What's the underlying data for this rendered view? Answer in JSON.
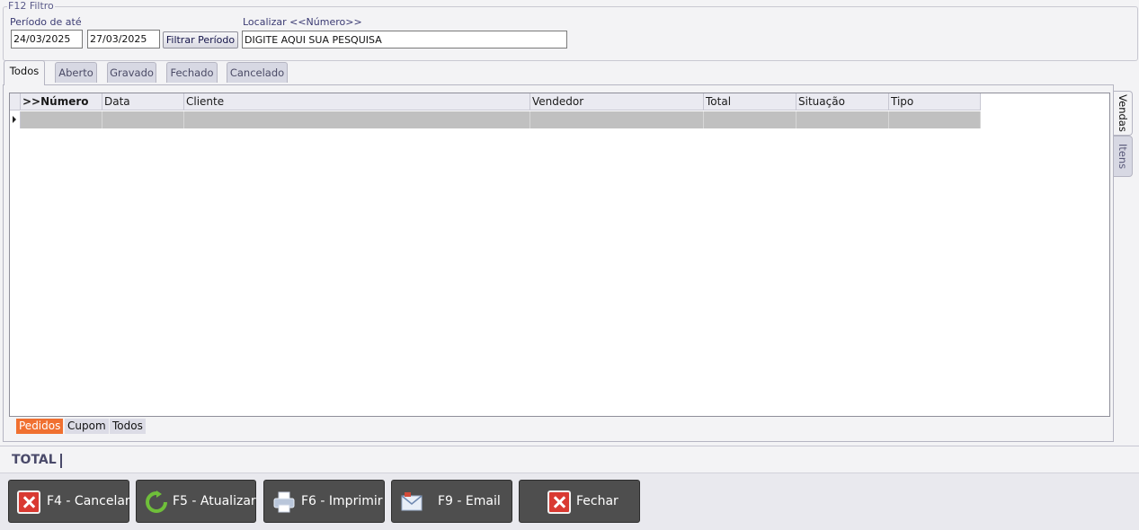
{
  "filter": {
    "legend": "F12 Filtro",
    "period_label": "Período de  até",
    "date_from": "24/03/2025",
    "date_to": "27/03/2025",
    "filter_button": "Filtrar Período",
    "search_label": "Localizar <<Número>>",
    "search_value": "DIGITE AQUI SUA PESQUISA"
  },
  "tabs": [
    "Todos",
    "Aberto",
    "Gravado",
    "Fechado",
    "Cancelado"
  ],
  "grid": {
    "columns": [
      ">>Número",
      "Data",
      "Cliente",
      "Vendedor",
      "Total",
      "Situação",
      "Tipo"
    ],
    "rows": [
      [
        "",
        "",
        "",
        "",
        "",
        "",
        ""
      ]
    ]
  },
  "subtabs": [
    "Pedidos",
    "Cupom",
    "Todos"
  ],
  "side_tabs": [
    "Vendas",
    "Itens"
  ],
  "total_label": "TOTAL",
  "actions": [
    {
      "label": "F4 - Cancelar",
      "icon": "cancel-icon"
    },
    {
      "label": "F5 - Atualizar",
      "icon": "refresh-icon"
    },
    {
      "label": "F6 - Imprimir",
      "icon": "printer-icon"
    },
    {
      "label": "F9 - Email",
      "icon": "email-icon"
    },
    {
      "label": "Fechar",
      "icon": "close-icon"
    }
  ],
  "colors": {
    "accent_tab": "#f07030",
    "button_bg": "#4e4e4e",
    "row_selected": "#c0c0c0"
  }
}
